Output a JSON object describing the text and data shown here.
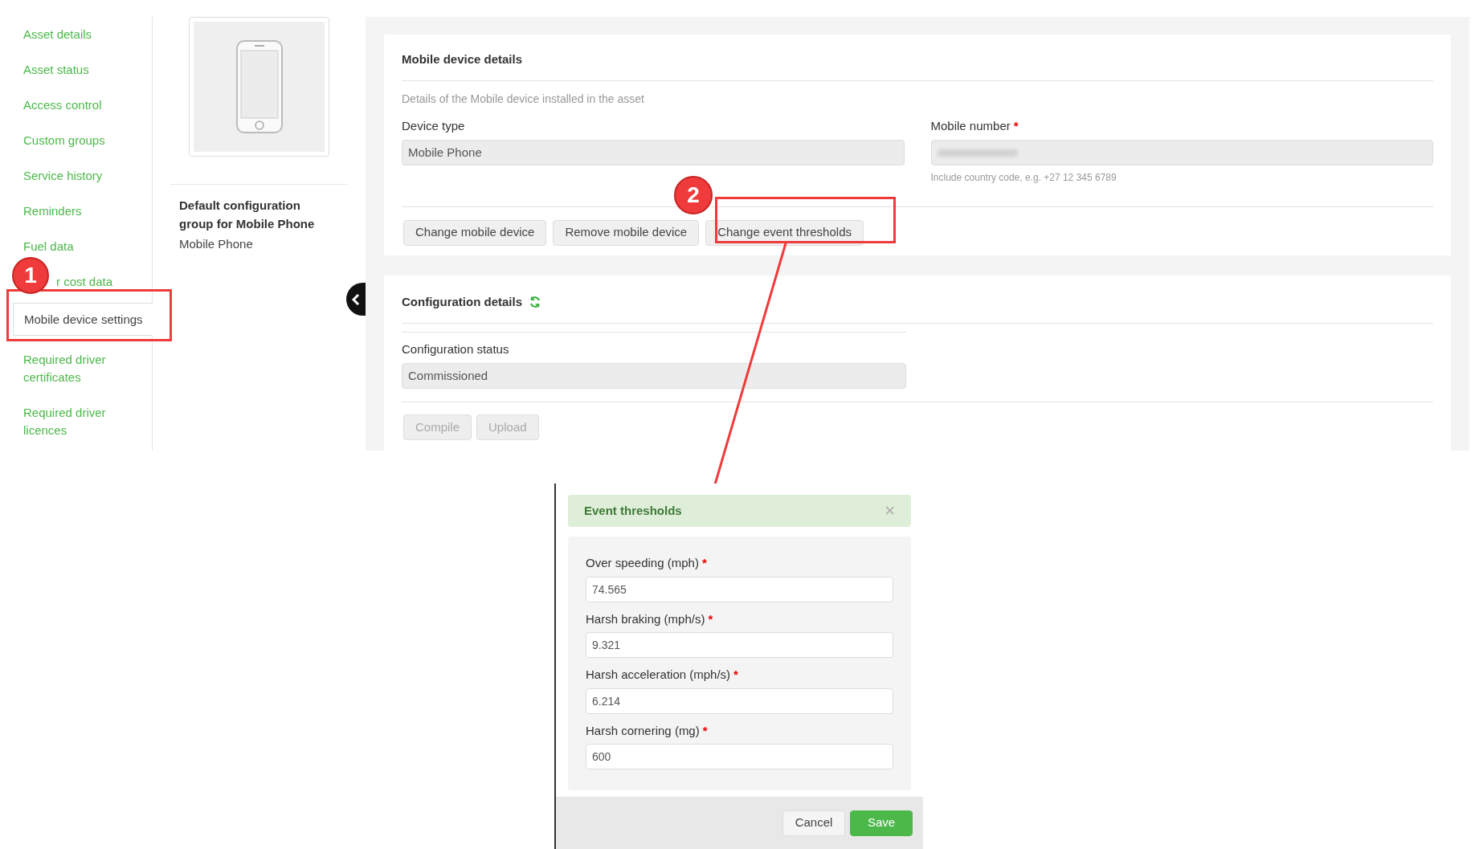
{
  "sidebar": {
    "items": [
      {
        "label": "Asset details",
        "selected": false
      },
      {
        "label": "Asset status",
        "selected": false
      },
      {
        "label": "Access control",
        "selected": false
      },
      {
        "label": "Custom groups",
        "selected": false
      },
      {
        "label": "Service history",
        "selected": false
      },
      {
        "label": "Reminders",
        "selected": false
      },
      {
        "label": "Fuel data",
        "selected": false
      },
      {
        "label": "r cost data",
        "selected": false
      },
      {
        "label": "Mobile device settings",
        "selected": true
      },
      {
        "label": "Required driver certificates",
        "selected": false
      },
      {
        "label": "Required driver licences",
        "selected": false
      }
    ]
  },
  "default_config": {
    "title": "Default configuration group for Mobile Phone",
    "value": "Mobile Phone"
  },
  "mobile_device_details": {
    "title": "Mobile device details",
    "description": "Details of the Mobile device installed in the asset",
    "fields": [
      {
        "label": "Device type",
        "value": "Mobile Phone"
      },
      {
        "label": "Mobile number",
        "required_mark": "*",
        "value_blurred": true,
        "hint": "Include country code, e.g. +27 12 345 6789"
      }
    ],
    "buttons": [
      {
        "label": "Change mobile device",
        "disabled": false
      },
      {
        "label": "Remove mobile device",
        "disabled": false
      },
      {
        "label": "Change event thresholds",
        "disabled": false
      }
    ]
  },
  "configuration_details": {
    "title": "Configuration details",
    "status_label": "Configuration status",
    "status_value": "Commissioned",
    "buttons": [
      {
        "label": "Compile",
        "disabled": true
      },
      {
        "label": "Upload",
        "disabled": true
      }
    ]
  },
  "annotations": [
    {
      "label": "1"
    },
    {
      "label": "2"
    }
  ],
  "dialog": {
    "title": "Event thresholds",
    "close": "×",
    "fields": [
      {
        "label": "Over speeding (mph)",
        "value": "74.565",
        "required_mark": "*"
      },
      {
        "label": "Harsh braking (mph/s)",
        "value": "9.321",
        "required_mark": "*"
      },
      {
        "label": "Harsh acceleration (mph/s)",
        "value": "6.214",
        "required_mark": "*"
      },
      {
        "label": "Harsh cornering (mg)",
        "value": "600",
        "required_mark": "*"
      }
    ],
    "buttons": [
      {
        "label": "Cancel",
        "kind": "secondary"
      },
      {
        "label": "Save",
        "kind": "primary"
      }
    ]
  }
}
